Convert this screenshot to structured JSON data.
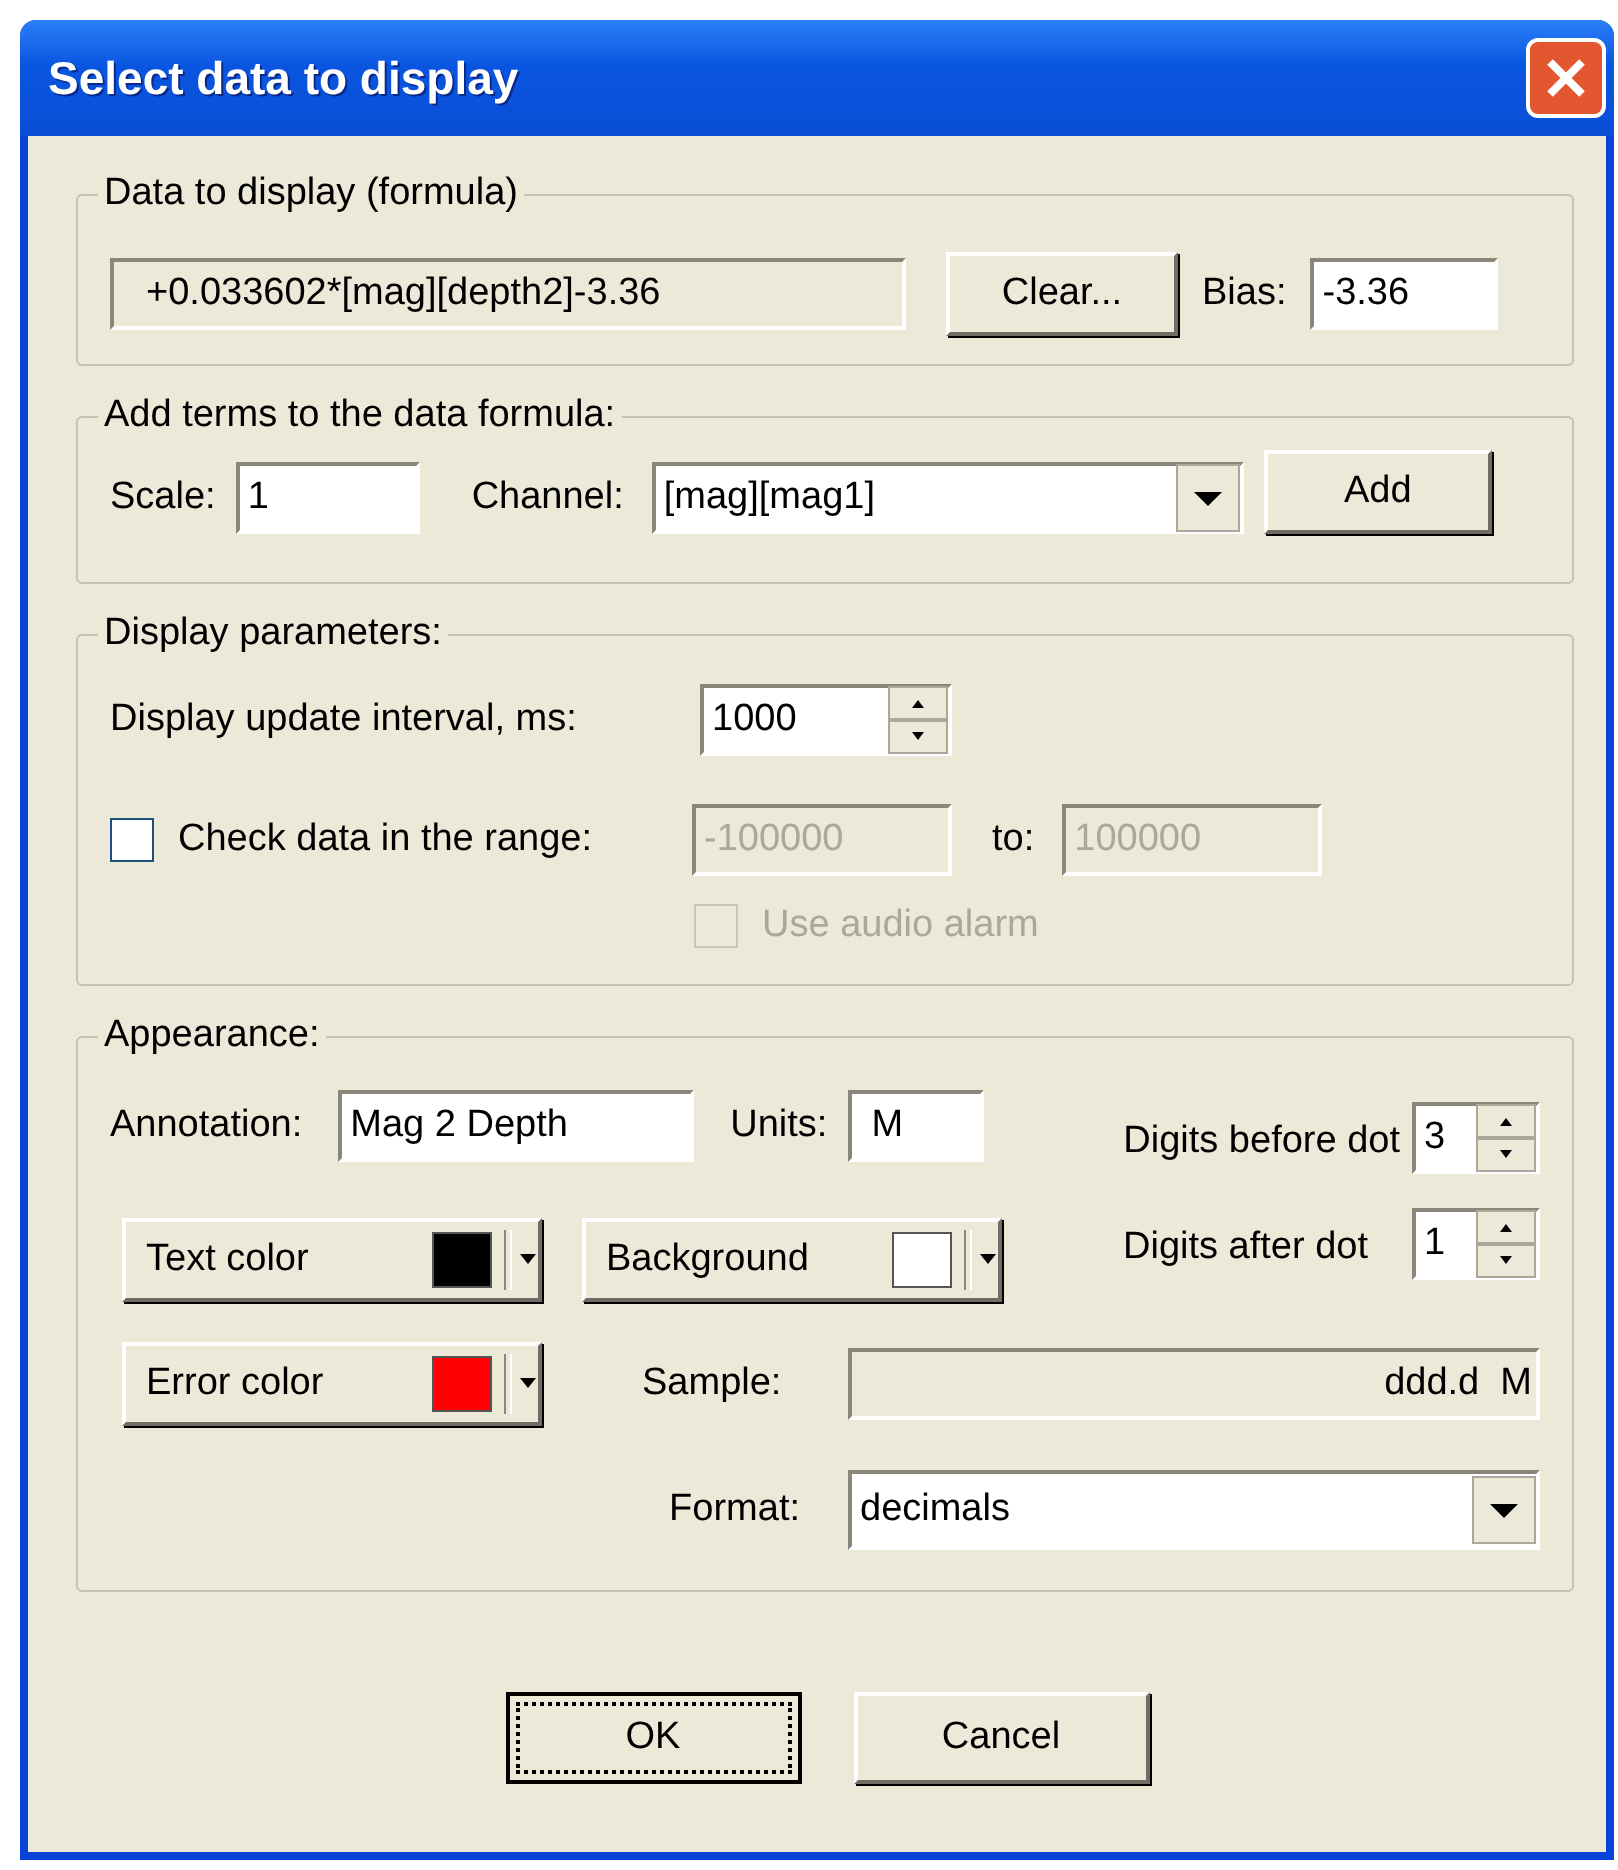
{
  "window": {
    "title": "Select data to display"
  },
  "formula_group": {
    "label": "Data to display (formula)",
    "formula": "+0.033602*[mag][depth2]-3.36",
    "clear_button": "Clear...",
    "bias_label": "Bias:",
    "bias": "-3.36"
  },
  "terms_group": {
    "label": "Add terms to the data formula:",
    "scale_label": "Scale:",
    "scale": "1",
    "channel_label": "Channel:",
    "channel": "[mag][mag1]",
    "add_button": "Add"
  },
  "display_group": {
    "label": "Display parameters:",
    "interval_label": "Display update interval, ms:",
    "interval": "1000",
    "range_check": {
      "label": "Check data in the range:",
      "checked": false
    },
    "range_from": {
      "value": "-100000",
      "disabled": true
    },
    "to_label": "to:",
    "range_to": {
      "value": "100000",
      "disabled": true
    },
    "audio_alarm": {
      "label": "Use audio alarm",
      "checked": false,
      "disabled": true
    }
  },
  "appearance_group": {
    "label": "Appearance:",
    "annotation_label": "Annotation:",
    "annotation": "Mag 2 Depth",
    "units_label": "Units:",
    "units": "M",
    "digits_before_label": "Digits before dot",
    "digits_before": "3",
    "digits_after_label": "Digits after dot",
    "digits_after": "1",
    "color_buttons": [
      {
        "label": "Text color",
        "color": "#000000"
      },
      {
        "label": "Background",
        "color": "#ffffff"
      },
      {
        "label": "Error color",
        "color": "#ff0000"
      }
    ],
    "sample_label": "Sample:",
    "sample": "ddd.d  M",
    "format_label": "Format:",
    "format": "decimals"
  },
  "buttons": [
    {
      "label": "OK",
      "focused": true
    },
    {
      "label": "Cancel",
      "focused": false
    }
  ]
}
